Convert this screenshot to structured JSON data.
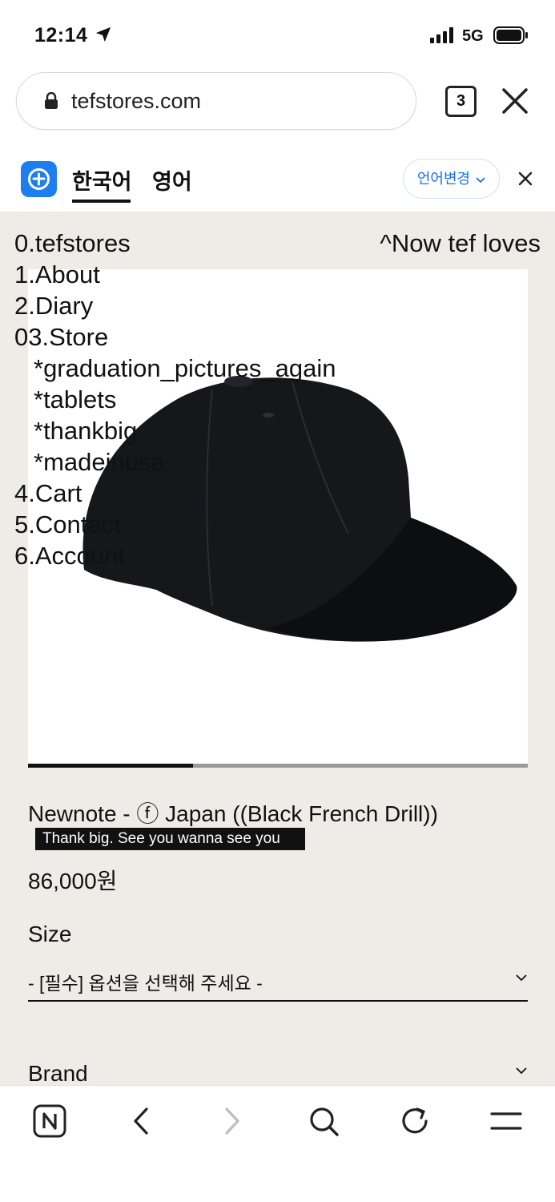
{
  "status": {
    "time": "12:14",
    "network": "5G"
  },
  "browser": {
    "url": "tefstores.com",
    "tab_count": "3"
  },
  "translate": {
    "tab_korean": "한국어",
    "tab_english": "영어",
    "change_button": "언어변경"
  },
  "menu": {
    "home": "0.tefstores",
    "about": "1.About",
    "diary": "2.Diary",
    "store": "03.Store",
    "sub": [
      "*graduation_pictures_again",
      "*tablets",
      "*thankbig",
      "*madeinusa"
    ],
    "cart": "4.Cart",
    "contact": "5.Contact",
    "account": "6.Account"
  },
  "corner_link": "^Now tef loves",
  "gallery": {
    "progress": 0.33
  },
  "product": {
    "title": "Newnote - ⓕ Japan ((Black French Drill))",
    "tag": "Thank big. See you wanna see you",
    "price": "86,000원",
    "size_label": "Size",
    "size_placeholder": "- [필수] 옵션을 선택해 주세요 -",
    "brand_label": "Brand"
  },
  "colors": {
    "page_bg": "#eeece6",
    "accent": "#1a73e8",
    "logo": "#1e7ef0"
  }
}
